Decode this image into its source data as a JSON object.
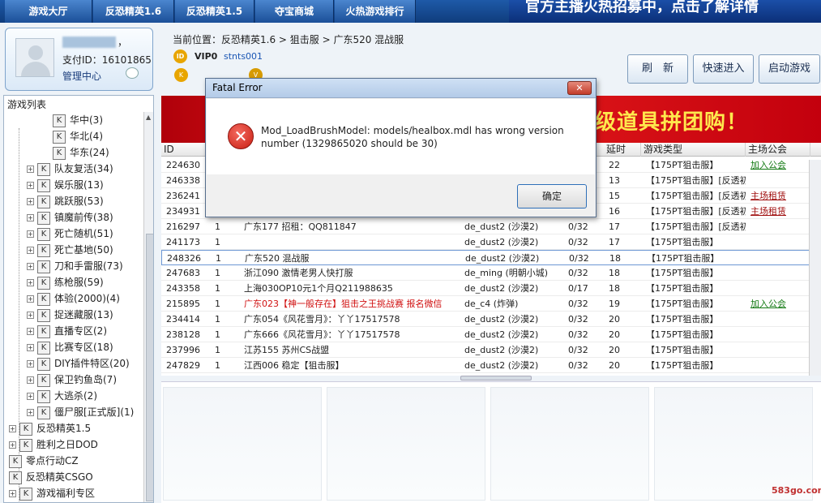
{
  "nav": {
    "tabs": [
      "游戏大厅",
      "反恐精英1.6",
      "反恐精英1.5",
      "夺宝商城",
      "火热游戏排行"
    ],
    "banner_text": "官方主播火热招募中，点击了解详情"
  },
  "user": {
    "name_suffix": "，",
    "pay_id_label": "支付ID：",
    "pay_id": "16101865",
    "manage_label": "管理中心"
  },
  "gamelist": {
    "title": "游戏列表",
    "items": [
      {
        "label": "华中(3)"
      },
      {
        "label": "华北(4)"
      },
      {
        "label": "华东(24)"
      },
      {
        "label": "队友复活(34)"
      },
      {
        "label": "娱乐服(13)"
      },
      {
        "label": "跳跃服(53)"
      },
      {
        "label": "镇魔前传(38)"
      },
      {
        "label": "死亡随机(51)"
      },
      {
        "label": "死亡基地(50)"
      },
      {
        "label": "刀和手雷服(73)"
      },
      {
        "label": "练枪服(59)"
      },
      {
        "label": "体验(2000)(4)"
      },
      {
        "label": "捉迷藏服(13)"
      },
      {
        "label": "直播专区(2)"
      },
      {
        "label": "比赛专区(18)"
      },
      {
        "label": "DIY插件特区(20)"
      },
      {
        "label": "保卫钓鱼岛(7)"
      },
      {
        "label": "大逃杀(2)"
      },
      {
        "label": "僵尸服[正式版](1)"
      },
      {
        "label": "反恐精英1.5"
      },
      {
        "label": "胜利之日DOD"
      },
      {
        "label": "零点行动CZ"
      },
      {
        "label": "反恐精英CSGO"
      },
      {
        "label": "游戏福利专区"
      }
    ]
  },
  "header": {
    "breadcrumb": "当前位置：反恐精英1.6 > 狙击服 > 广东520 混战服",
    "vip_label": "VIP0",
    "vip_name": "stnts001",
    "refresh_label": "刷　新",
    "quick_join_label": "快速进入",
    "start_label": "启动游戏"
  },
  "banner": {
    "text": "级道具拼团购！"
  },
  "table": {
    "headers": [
      "ID",
      "延时",
      "游戏类型",
      "主场公会"
    ],
    "rows": [
      {
        "id": "224630",
        "num": "",
        "name": "",
        "map": "",
        "players": "",
        "ping": "22",
        "type": "【175PT狙击服】",
        "guild": "加入公会",
        "guild_style": "link"
      },
      {
        "id": "246338",
        "num": "",
        "name": "",
        "map": "",
        "players": "",
        "ping": "13",
        "type": "【175PT狙击服】[反透初",
        "guild": "",
        "guild_style": ""
      },
      {
        "id": "236241",
        "num": "",
        "name": "",
        "map": "",
        "players": "",
        "ping": "15",
        "type": "【175PT狙击服】[反透初",
        "guild": "主场租赁",
        "guild_style": "link-red"
      },
      {
        "id": "234931",
        "num": "",
        "name": "",
        "map": "",
        "players": "",
        "ping": "16",
        "type": "【175PT狙击服】[反透初",
        "guild": "主场租赁",
        "guild_style": "link-red"
      },
      {
        "id": "216297",
        "num": "1",
        "name": "广东177 招租：QQ811847",
        "map": "de_dust2 (沙漠2)",
        "players": "0/32",
        "ping": "17",
        "type": "【175PT狙击服】[反透初",
        "guild": "",
        "guild_style": ""
      },
      {
        "id": "241173",
        "num": "1",
        "name": "",
        "map": "de_dust2 (沙漠2)",
        "players": "0/32",
        "ping": "17",
        "type": "【175PT狙击服】",
        "guild": "",
        "guild_style": ""
      },
      {
        "id": "248326",
        "num": "1",
        "name": "广东520 混战服",
        "map": "de_dust2 (沙漠2)",
        "players": "0/32",
        "ping": "18",
        "type": "【175PT狙击服】",
        "guild": "",
        "guild_style": ""
      },
      {
        "id": "247683",
        "num": "1",
        "name": "浙江090 激情老男人快打服",
        "map": "de_ming (明朝小城)",
        "players": "0/32",
        "ping": "18",
        "type": "【175PT狙击服】",
        "guild": "",
        "guild_style": ""
      },
      {
        "id": "243358",
        "num": "1",
        "name": "上海030OP10元1个月Q211988635",
        "map": "de_dust2 (沙漠2)",
        "players": "0/17",
        "ping": "18",
        "type": "【175PT狙击服】",
        "guild": "",
        "guild_style": ""
      },
      {
        "id": "215895",
        "num": "1",
        "name": "广东023【神一般存在】狙击之王挑战赛 报名微信",
        "map": "de_c4 (炸弹)",
        "players": "0/32",
        "ping": "19",
        "type": "【175PT狙击服】",
        "guild": "加入公会",
        "guild_style": "link",
        "red": true
      },
      {
        "id": "234414",
        "num": "1",
        "name": "广东054《风花雪月》：丫丫17517578",
        "map": "de_dust2 (沙漠2)",
        "players": "0/32",
        "ping": "20",
        "type": "【175PT狙击服】",
        "guild": "",
        "guild_style": ""
      },
      {
        "id": "238128",
        "num": "1",
        "name": "广东666《风花雪月》：丫丫17517578",
        "map": "de_dust2 (沙漠2)",
        "players": "0/32",
        "ping": "20",
        "type": "【175PT狙击服】",
        "guild": "",
        "guild_style": ""
      },
      {
        "id": "237996",
        "num": "1",
        "name": "江苏155 苏州CS战盟",
        "map": "de_dust2 (沙漠2)",
        "players": "0/32",
        "ping": "20",
        "type": "【175PT狙击服】",
        "guild": "",
        "guild_style": ""
      },
      {
        "id": "247829",
        "num": "1",
        "name": "江西006 稳定【狙击服】",
        "map": "de_dust2 (沙漠2)",
        "players": "0/32",
        "ping": "20",
        "type": "【175PT狙击服】",
        "guild": "",
        "guild_style": ""
      }
    ]
  },
  "dialog": {
    "title": "Fatal Error",
    "message": "Mod_LoadBrushModel: models/healbox.mdl has wrong version number (1329865020 should be 30)",
    "ok_label": "确定"
  },
  "watermark": "583go.com"
}
